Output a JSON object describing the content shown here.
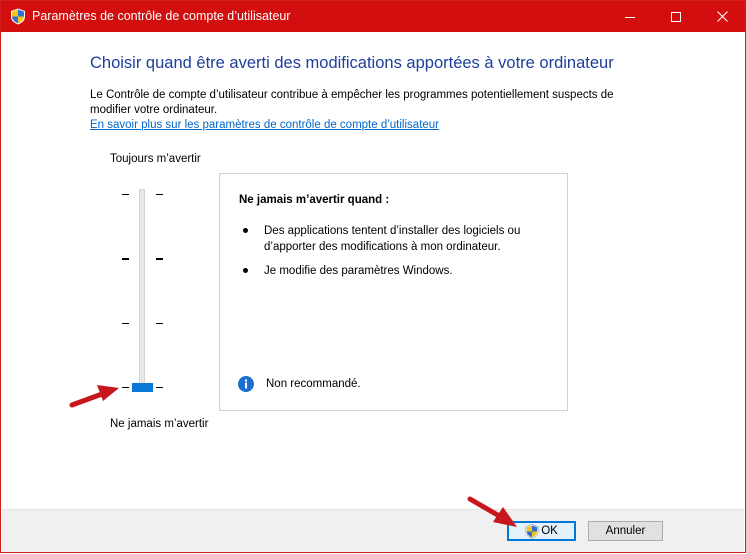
{
  "window": {
    "title": "Paramètres de contrôle de compte d’utilisateur",
    "titlebar_color": "#d20e0e",
    "controls": {
      "minimize_icon": "minimize-icon",
      "maximize_icon": "maximize-icon",
      "close_icon": "close-icon"
    }
  },
  "main": {
    "heading": "Choisir quand être averti des modifications apportées à votre ordinateur",
    "description": "Le Contrôle de compte d’utilisateur contribue à empêcher les programmes potentiellement suspects de modifier votre ordinateur.",
    "learn_more_link": "En savoir plus sur les paramètres de contrôle de compte d’utilisateur"
  },
  "slider": {
    "top_label": "Toujours m’avertir",
    "bottom_label": "Ne jamais m’avertir",
    "levels": 4,
    "selected_level": 1,
    "thumb_color": "#0a78d7"
  },
  "info_box": {
    "title": "Ne jamais m’avertir quand :",
    "items": [
      "Des applications tentent d’installer des logiciels ou d’apporter des modifications à mon ordinateur.",
      "Je modifie des paramètres Windows."
    ],
    "note_icon": "info-icon",
    "note": "Non recommandé."
  },
  "footer": {
    "ok_label": "OK",
    "ok_icon": "uac-shield-icon",
    "cancel_label": "Annuler"
  },
  "colors": {
    "heading": "#1e3f9b",
    "link": "#0066cc",
    "accent": "#0078d7",
    "annotation_arrow": "#c8161d"
  }
}
